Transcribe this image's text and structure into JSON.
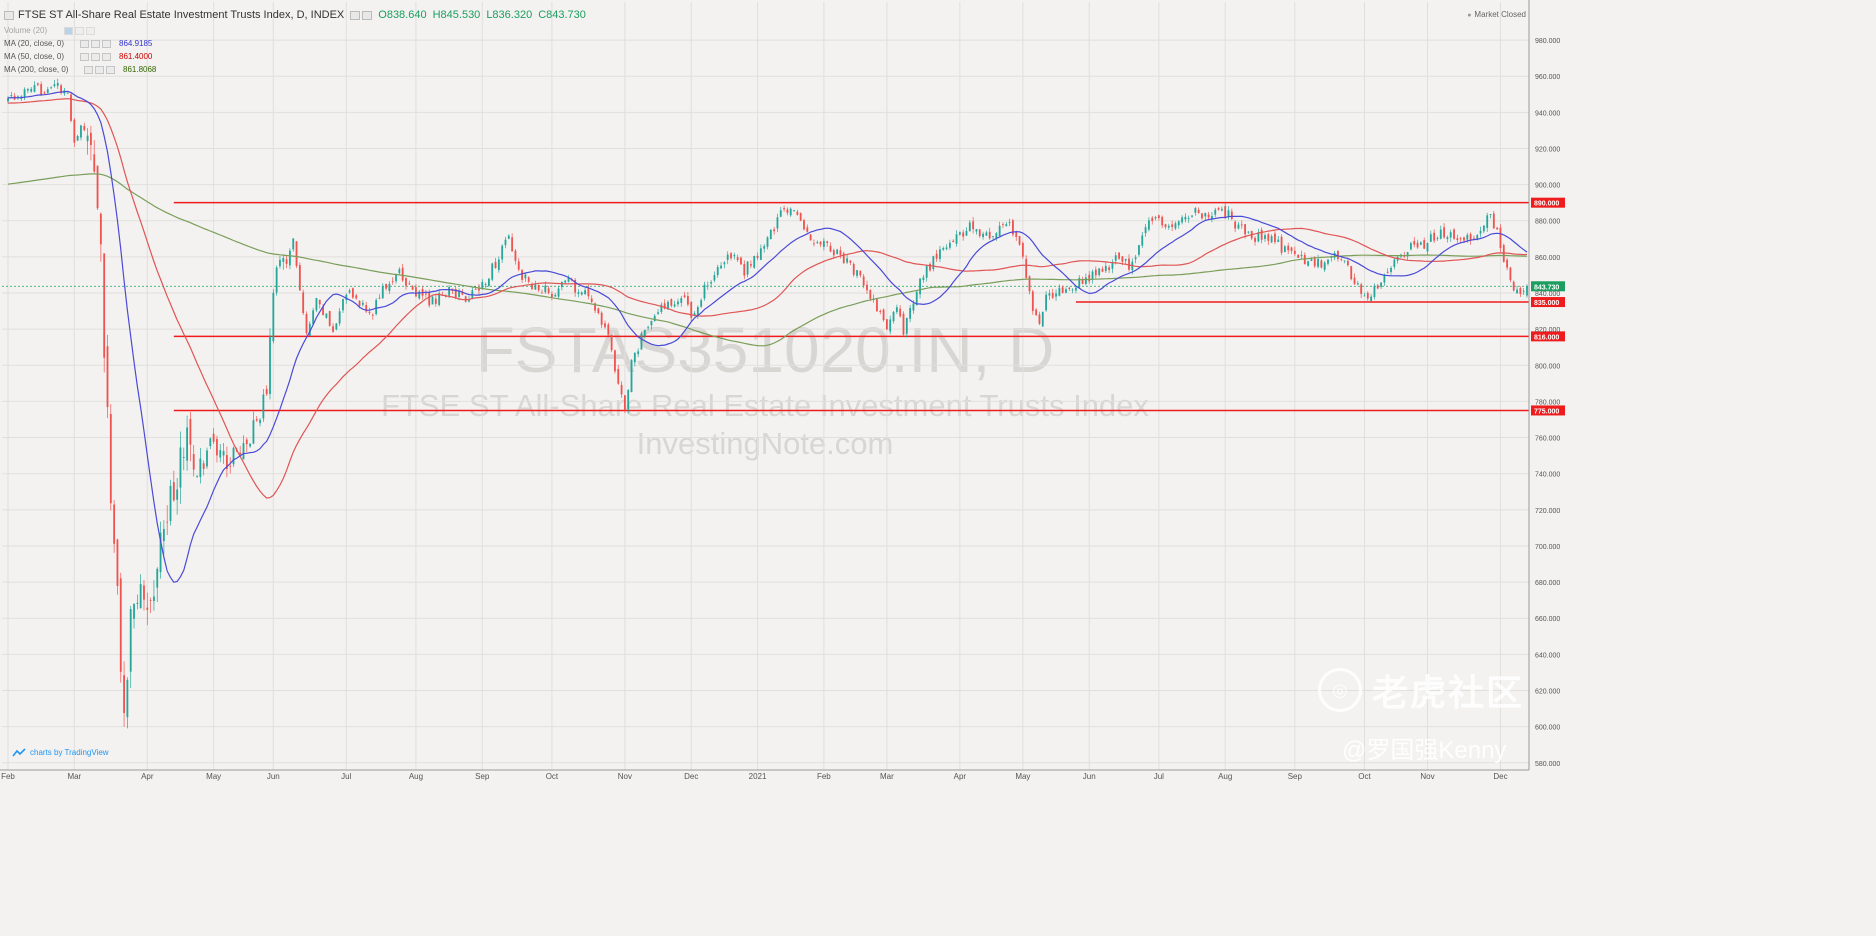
{
  "header": {
    "symbol_title": "FTSE ST All-Share Real Estate Investment Trusts Index, D, INDEX",
    "open": "O838.640",
    "high": "H845.530",
    "low": "L836.320",
    "close": "C843.730"
  },
  "indicators": [
    {
      "label": "Volume (20)",
      "value": "",
      "color": "#9ec6e8"
    },
    {
      "label": "MA (20, close, 0)",
      "value": "864.9185",
      "color": "#3333cc"
    },
    {
      "label": "MA (50, close, 0)",
      "value": "861.4000",
      "color": "#cc0000"
    },
    {
      "label": "MA (200, close, 0)",
      "value": "861.8068",
      "color": "#336600"
    }
  ],
  "market_status": "Market Closed",
  "branding": "charts by TradingView",
  "watermark": {
    "line1": "FSTAS351020.IN, D",
    "line2": "FTSE ST All-Share Real Estate Investment Trusts Index",
    "line3": "InvestingNote.com",
    "logo_text": "老虎社区",
    "user": "@罗国强Kenny"
  },
  "colors": {
    "up": "#26a69a",
    "down": "#ef5350",
    "ma20": "#4a4ad8",
    "ma50": "#e05555",
    "ma200": "#7a9e5a",
    "hline": "#ee1c1c",
    "price_tag": "#1b9e5f"
  },
  "chart_data": {
    "type": "candlestick",
    "title": "FTSE ST All-Share Real Estate Investment Trusts Index, D, INDEX",
    "ylim": [
      576,
      990
    ],
    "y_ticks": [
      580,
      600,
      620,
      640,
      660,
      680,
      700,
      720,
      740,
      760,
      780,
      800,
      820,
      840,
      860,
      880,
      900,
      920,
      940,
      960,
      980
    ],
    "y_tick_labels": [
      "580.000",
      "600.000",
      "620.000",
      "640.000",
      "660.000",
      "680.000",
      "700.000",
      "720.000",
      "740.000",
      "760.000",
      "780.000",
      "800.000",
      "820.000",
      "840.000",
      "860.000",
      "880.000",
      "900.000",
      "920.000",
      "940.000",
      "960.000",
      "980.000"
    ],
    "x_labels": [
      "Feb",
      "Mar",
      "Apr",
      "May",
      "Jun",
      "Jul",
      "Aug",
      "Sep",
      "Oct",
      "Nov",
      "Dec",
      "2021",
      "Feb",
      "Mar",
      "Apr",
      "May",
      "Jun",
      "Jul",
      "Aug",
      "Sep",
      "Oct",
      "Nov",
      "Dec"
    ],
    "x_label_idx": [
      0,
      20,
      42,
      62,
      80,
      102,
      123,
      143,
      164,
      186,
      206,
      226,
      246,
      265,
      287,
      306,
      326,
      347,
      367,
      388,
      409,
      428,
      450
    ],
    "n_bars": 459,
    "hlines": [
      {
        "value": 890,
        "label": "890.000",
        "start_idx": 50
      },
      {
        "value": 835,
        "label": "835.000",
        "start_idx": 322
      },
      {
        "value": 816,
        "label": "816.000",
        "start_idx": 50
      },
      {
        "value": 775,
        "label": "775.000",
        "start_idx": 50
      }
    ],
    "last_price": {
      "value": 843.73,
      "label": "843.730"
    },
    "close_anchors": [
      [
        0,
        948
      ],
      [
        8,
        952
      ],
      [
        14,
        955
      ],
      [
        18,
        948
      ],
      [
        20,
        925
      ],
      [
        24,
        935
      ],
      [
        28,
        860
      ],
      [
        30,
        770
      ],
      [
        32,
        700
      ],
      [
        35,
        610
      ],
      [
        37,
        660
      ],
      [
        40,
        690
      ],
      [
        43,
        665
      ],
      [
        46,
        705
      ],
      [
        50,
        735
      ],
      [
        54,
        755
      ],
      [
        58,
        740
      ],
      [
        62,
        760
      ],
      [
        66,
        745
      ],
      [
        72,
        760
      ],
      [
        76,
        770
      ],
      [
        78,
        790
      ],
      [
        80,
        845
      ],
      [
        84,
        860
      ],
      [
        86,
        870
      ],
      [
        88,
        840
      ],
      [
        90,
        815
      ],
      [
        93,
        835
      ],
      [
        98,
        820
      ],
      [
        102,
        840
      ],
      [
        106,
        835
      ],
      [
        110,
        830
      ],
      [
        114,
        845
      ],
      [
        118,
        850
      ],
      [
        123,
        840
      ],
      [
        128,
        835
      ],
      [
        133,
        842
      ],
      [
        138,
        836
      ],
      [
        143,
        845
      ],
      [
        148,
        860
      ],
      [
        151,
        870
      ],
      [
        154,
        852
      ],
      [
        158,
        843
      ],
      [
        164,
        840
      ],
      [
        168,
        847
      ],
      [
        172,
        842
      ],
      [
        176,
        835
      ],
      [
        180,
        822
      ],
      [
        184,
        790
      ],
      [
        186,
        775
      ],
      [
        188,
        800
      ],
      [
        192,
        820
      ],
      [
        196,
        830
      ],
      [
        200,
        835
      ],
      [
        204,
        840
      ],
      [
        206,
        828
      ],
      [
        210,
        842
      ],
      [
        214,
        855
      ],
      [
        218,
        860
      ],
      [
        222,
        852
      ],
      [
        226,
        862
      ],
      [
        230,
        872
      ],
      [
        233,
        885
      ],
      [
        236,
        888
      ],
      [
        239,
        878
      ],
      [
        242,
        868
      ],
      [
        246,
        870
      ],
      [
        250,
        862
      ],
      [
        254,
        855
      ],
      [
        258,
        845
      ],
      [
        262,
        830
      ],
      [
        265,
        822
      ],
      [
        268,
        830
      ],
      [
        270,
        818
      ],
      [
        273,
        835
      ],
      [
        276,
        850
      ],
      [
        280,
        860
      ],
      [
        284,
        868
      ],
      [
        287,
        872
      ],
      [
        290,
        878
      ],
      [
        294,
        870
      ],
      [
        298,
        875
      ],
      [
        302,
        880
      ],
      [
        306,
        860
      ],
      [
        309,
        830
      ],
      [
        311,
        822
      ],
      [
        313,
        838
      ],
      [
        317,
        840
      ],
      [
        321,
        845
      ],
      [
        326,
        848
      ],
      [
        330,
        852
      ],
      [
        334,
        858
      ],
      [
        338,
        855
      ],
      [
        342,
        870
      ],
      [
        345,
        882
      ],
      [
        347,
        880
      ],
      [
        350,
        875
      ],
      [
        354,
        880
      ],
      [
        358,
        885
      ],
      [
        362,
        882
      ],
      [
        365,
        888
      ],
      [
        367,
        885
      ],
      [
        370,
        878
      ],
      [
        374,
        872
      ],
      [
        378,
        870
      ],
      [
        382,
        868
      ],
      [
        386,
        862
      ],
      [
        388,
        860
      ],
      [
        392,
        858
      ],
      [
        396,
        855
      ],
      [
        400,
        862
      ],
      [
        403,
        858
      ],
      [
        405,
        848
      ],
      [
        408,
        840
      ],
      [
        410,
        838
      ],
      [
        413,
        845
      ],
      [
        416,
        852
      ],
      [
        420,
        860
      ],
      [
        424,
        866
      ],
      [
        428,
        868
      ],
      [
        432,
        874
      ],
      [
        436,
        872
      ],
      [
        440,
        870
      ],
      [
        444,
        876
      ],
      [
        447,
        882
      ],
      [
        449,
        875
      ],
      [
        451,
        860
      ],
      [
        453,
        848
      ],
      [
        455,
        840
      ],
      [
        456,
        838.64
      ],
      [
        458,
        843.73
      ]
    ]
  }
}
